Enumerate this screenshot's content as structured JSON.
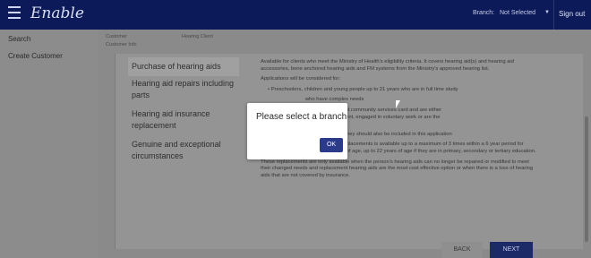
{
  "header": {
    "brand": "Enable",
    "branch_label": "Branch:",
    "branch_value": "Not Selected",
    "sign_out": "Sign out"
  },
  "sidebar": {
    "items": [
      {
        "label": "Search"
      },
      {
        "label": "Create Customer"
      }
    ]
  },
  "breadcrumb": {
    "customer_label": "Customer",
    "customer_value": "Hearing Client",
    "customer_sub": "Customer Info"
  },
  "steps": [
    {
      "label": "Purchase of hearing aids"
    },
    {
      "label": "Hearing aid repairs including parts"
    },
    {
      "label": "Hearing aid insurance replacement"
    },
    {
      "label": "Genuine and exceptional circumstances"
    }
  ],
  "content": {
    "p1": "Available for clients who meet the Ministry of Health's eligibility criteria. It covers hearing aid(s) and hearing aid accessories, bone anchored hearing aids and FM systems from the Ministry's approved hearing list.",
    "p2": "Applications will be considered for:",
    "b1": "Preschoolers, children and young people up to 21 years who are in full time study",
    "b2": "who have complex needs",
    "b3": "who have a current community services card and are either",
    "b4": "seeking employment, engaged in voluntary work or are the",
    "b5": "person",
    "p3": "the hearing aids, they should also be included in this application",
    "p4": "*Funding for hearing aids and their replacements is available up to a maximum of 3 times within a 6 year period for preschoolers and those from 5 years of age, up to 22 years of age if they are in primary, secondary or tertiary education.",
    "p5": "These replacements are only available when the person's hearing aids can no longer be repaired or modified to meet their changed needs and replacement hearing aids are the most cost effective option or when there is a loss of hearing aids that are not covered by insurance."
  },
  "footer": {
    "back": "BACK",
    "next": "NEXT"
  },
  "modal": {
    "message": "Please select a branch",
    "ok": "OK"
  }
}
